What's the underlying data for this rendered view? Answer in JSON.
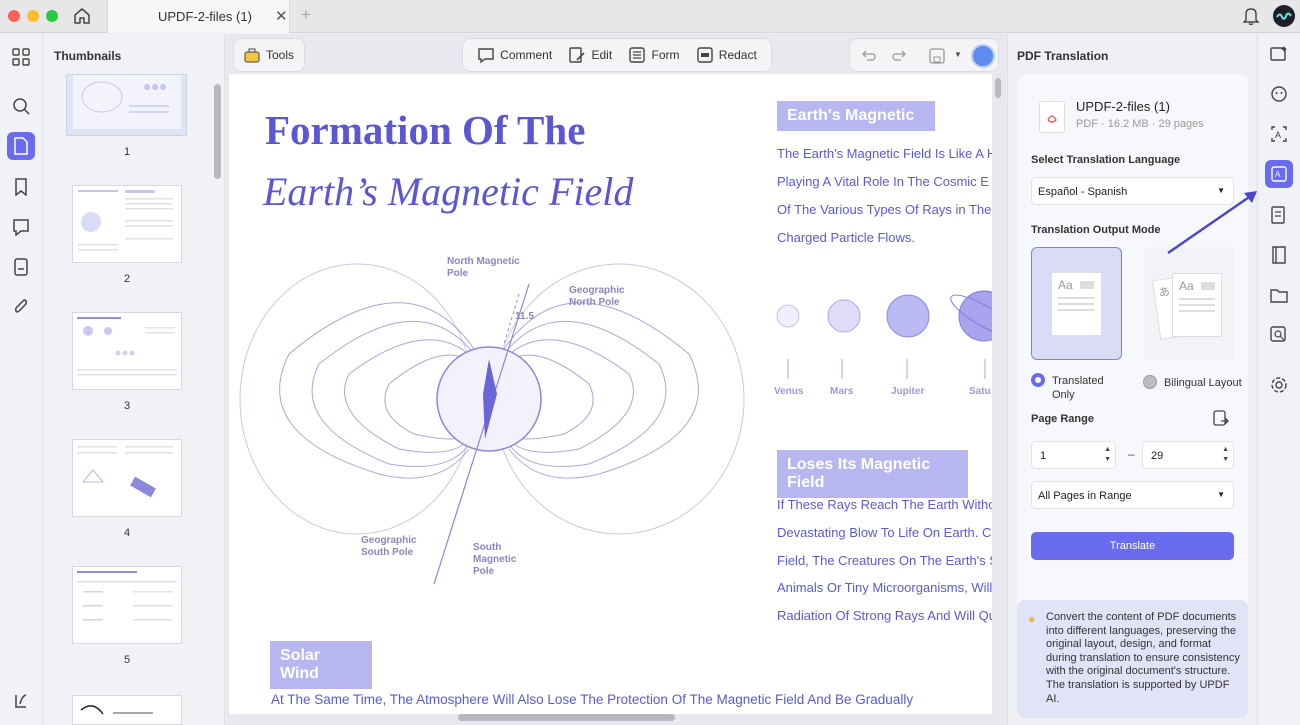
{
  "window": {
    "tab_title": "UPDF-2-files (1)",
    "tab_close": "✕",
    "tab_add": "+"
  },
  "thumbnails": {
    "title": "Thumbnails",
    "pages": [
      "1",
      "2",
      "3",
      "4",
      "5"
    ]
  },
  "toolbar": {
    "tools_label": "Tools",
    "comment_label": "Comment",
    "edit_label": "Edit",
    "form_label": "Form",
    "redact_label": "Redact"
  },
  "document": {
    "title_line1": "Formation Of The",
    "title_line2": "Earth’s Magnetic Field",
    "badge_magnetic": "Earth's Magnetic",
    "magnetic_lines": [
      "The Earth's Magnetic Field Is Like A H",
      "Playing A Vital Role In The Cosmic E",
      "Of The Various Types Of Rays in The",
      "Charged Particle Flows."
    ],
    "planets": [
      "Venus",
      "Mars",
      "Jupiter",
      "Satu"
    ],
    "badge_loses": "Loses Its Magnetic Field",
    "loses_lines": [
      "If These Rays Reach The Earth Witho",
      "Devastating Blow To Life On Earth. C",
      "Field, The Creatures On The Earth's S",
      "Animals Or Tiny Microorganisms, Will",
      "Radiation Of Strong Rays And Will Qu"
    ],
    "badge_solar": "Solar Wind",
    "bottom_line": "At The Same Time, The Atmosphere Will Also Lose The Protection Of The Magnetic Field And Be Gradually",
    "diagram": {
      "north_magnetic": "North Magnetic Pole",
      "geo_north": "Geographic North Pole",
      "angle": "11.5",
      "geo_south": "Geographic South Pole",
      "south_magnetic": "South Magnetic Pole"
    }
  },
  "translation_panel": {
    "title": "PDF Translation",
    "file_name": "UPDF-2-files (1)",
    "file_meta": "PDF · 16.2 MB · 29 pages",
    "language_label": "Select Translation Language",
    "language_value": "Español - Spanish",
    "output_mode_label": "Translation Output Mode",
    "mode_translated": "Translated Only",
    "mode_bilingual": "Bilingual Layout",
    "page_range_label": "Page Range",
    "range_start": "1",
    "range_end": "29",
    "range_option": "All Pages in Range",
    "translate_button": "Translate",
    "info_text": "Convert the content of PDF documents into different languages, preserving the original layout, design, and format during translation to ensure consistency with the original document's structure. The translation is supported by UPDF AI."
  },
  "colors": {
    "accent": "#6a6cf0",
    "doc_text": "#5b5bcf",
    "doc_badge": "#b7b6f0"
  }
}
